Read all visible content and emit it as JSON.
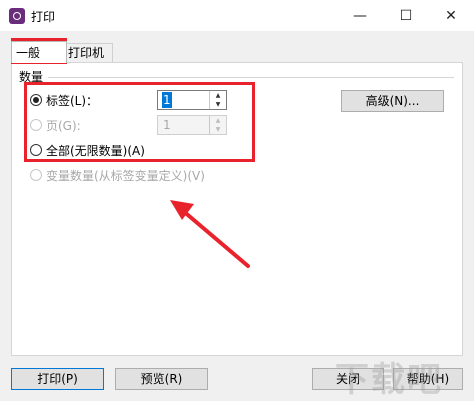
{
  "window": {
    "title": "打印",
    "minimize_glyph": "—",
    "maximize_glyph": "☐",
    "close_glyph": "✕"
  },
  "tabs": [
    {
      "label": "一般"
    },
    {
      "label": "打印机"
    }
  ],
  "quantity_group": {
    "label": "数量",
    "options": [
      {
        "label": "标签(L)：",
        "value": "1",
        "checked": true,
        "enabled": true
      },
      {
        "label": "页(G):",
        "value": "1",
        "checked": false,
        "enabled": false
      },
      {
        "label": "全部(无限数量)(A)",
        "checked": false,
        "enabled": true
      },
      {
        "label": "变量数量(从标签变量定义)(V)",
        "checked": false,
        "enabled": false
      }
    ],
    "advanced_button": "高级(N)..."
  },
  "buttons": {
    "print": "打印(P)",
    "preview": "预览(R)",
    "close": "关闭",
    "help": "帮助(H)"
  },
  "watermark": "下载吧",
  "colors": {
    "highlight": "#e8232b",
    "selection": "#0078d7"
  }
}
